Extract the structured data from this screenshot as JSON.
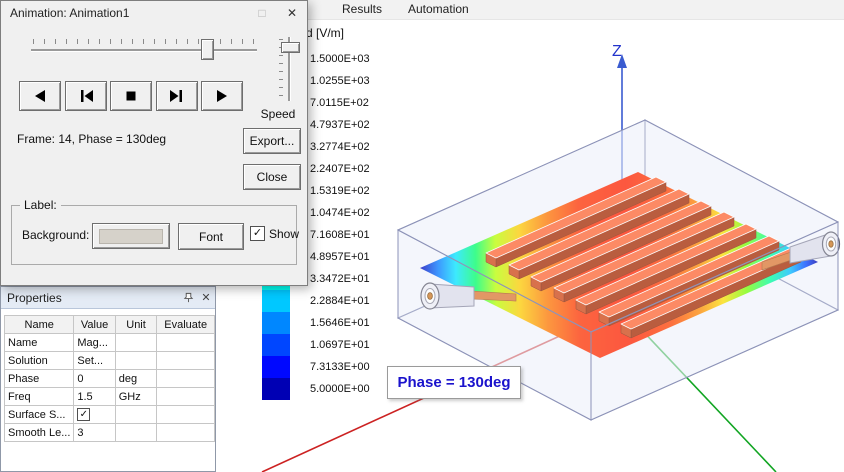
{
  "menubar": {
    "items": [
      "Results",
      "Automation"
    ]
  },
  "icons": {
    "maximize": "□",
    "close": "✕",
    "check": "✓"
  },
  "animation_dialog": {
    "title": "Animation: Animation1",
    "frame_text": "Frame: 14, Phase = 130deg",
    "speed_label": "Speed",
    "buttons": {
      "export": "Export...",
      "close": "Close",
      "font": "Font"
    },
    "label_group": {
      "title": "Label:",
      "background_label": "Background:",
      "show_label": "Show",
      "show_checked": true
    }
  },
  "properties_panel": {
    "title": "Properties",
    "columns": [
      "Name",
      "Value",
      "Unit",
      "Evaluate"
    ],
    "rows": [
      {
        "name": "Name",
        "value": "Mag...",
        "unit": "",
        "evaluate": ""
      },
      {
        "name": "Solution",
        "value": "Set...",
        "unit": "",
        "evaluate": ""
      },
      {
        "name": "Phase",
        "value": "0",
        "unit": "deg",
        "evaluate": ""
      },
      {
        "name": "Freq",
        "value": "1.5",
        "unit": "GHz",
        "evaluate": ""
      },
      {
        "name": "Surface S...",
        "value": true,
        "unit": "",
        "evaluate": ""
      },
      {
        "name": "Smooth Le...",
        "value": "3",
        "unit": "",
        "evaluate": ""
      }
    ]
  },
  "legend": {
    "title": "d [V/m]",
    "values": [
      "1.5000E+03",
      "1.0255E+03",
      "7.0115E+02",
      "4.7937E+02",
      "3.2774E+02",
      "2.2407E+02",
      "1.5319E+02",
      "1.0474E+02",
      "7.1608E+01",
      "4.8957E+01",
      "3.3472E+01",
      "2.2884E+01",
      "1.5646E+01",
      "1.0697E+01",
      "7.3133E+00",
      "5.0000E+00"
    ],
    "band_colors": [
      "#ff0000",
      "#ff5200",
      "#ff9100",
      "#ffc800",
      "#fff200",
      "#ccff00",
      "#8cff00",
      "#3cff00",
      "#00ff4e",
      "#00ffa0",
      "#00fff2",
      "#00c8ff",
      "#0087ff",
      "#0046ff",
      "#0008ff",
      "#0000b4"
    ]
  },
  "viewport": {
    "phase_label": "Phase = 130deg",
    "z_axis_label": "Z",
    "axis_colors": {
      "x": "#cc2222",
      "y": "#11a522",
      "z": "#3a5bd0"
    }
  }
}
